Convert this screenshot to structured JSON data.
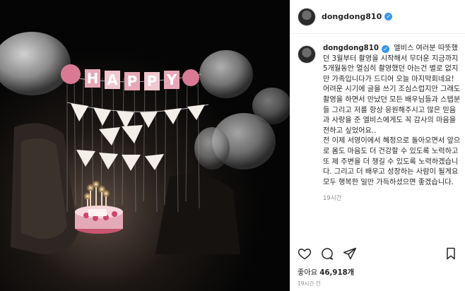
{
  "header": {
    "username": "dongdong810",
    "verified": true
  },
  "photo": {
    "banner_text": "HAPPY"
  },
  "caption": {
    "username": "dongdong810",
    "paragraphs": [
      "엘비스 여러분 따뜻했던 3월부터 촬영을 시작해서 무더운 지금까지 5개월동안 열심히 촬영했던 아는건 별로 없지만 가족입니다가 드디어 오늘 마지막회네요!",
      "어려운 시기에 글을 쓰기 조심스럽지만 그래도 촬영을 하면서 만났던 모든 배우님들과 스텝분들 그리고 저를 항상 응원해주시고 많은 믿음과 사랑을 준 엘비스에게도 꼭 감사의 마음을 전하고 싶었어요..",
      "전 이제 서영이에서 혜정으로 돌아오면서 앞으로 몸도 마음도 더 건강할 수 있도록 노력하고 또 제 주변을 더 챙길 수 있도록 노력하겠습니다. 그리고 더 배우고 성장하는 사람이 될게요 모두 행복한 일만 가득하셨으면 좋겠습니다."
    ],
    "time": "19시간"
  },
  "actions": {
    "like_icon": "heart-icon",
    "comment_icon": "comment-icon",
    "share_icon": "paper-plane-icon",
    "save_icon": "bookmark-icon"
  },
  "likes": {
    "label": "좋아요",
    "count": "46,918개"
  },
  "timestamp": "19시간 전",
  "colors": {
    "verified": "#3897f0",
    "text": "#262626",
    "muted": "#8e8e8e"
  }
}
